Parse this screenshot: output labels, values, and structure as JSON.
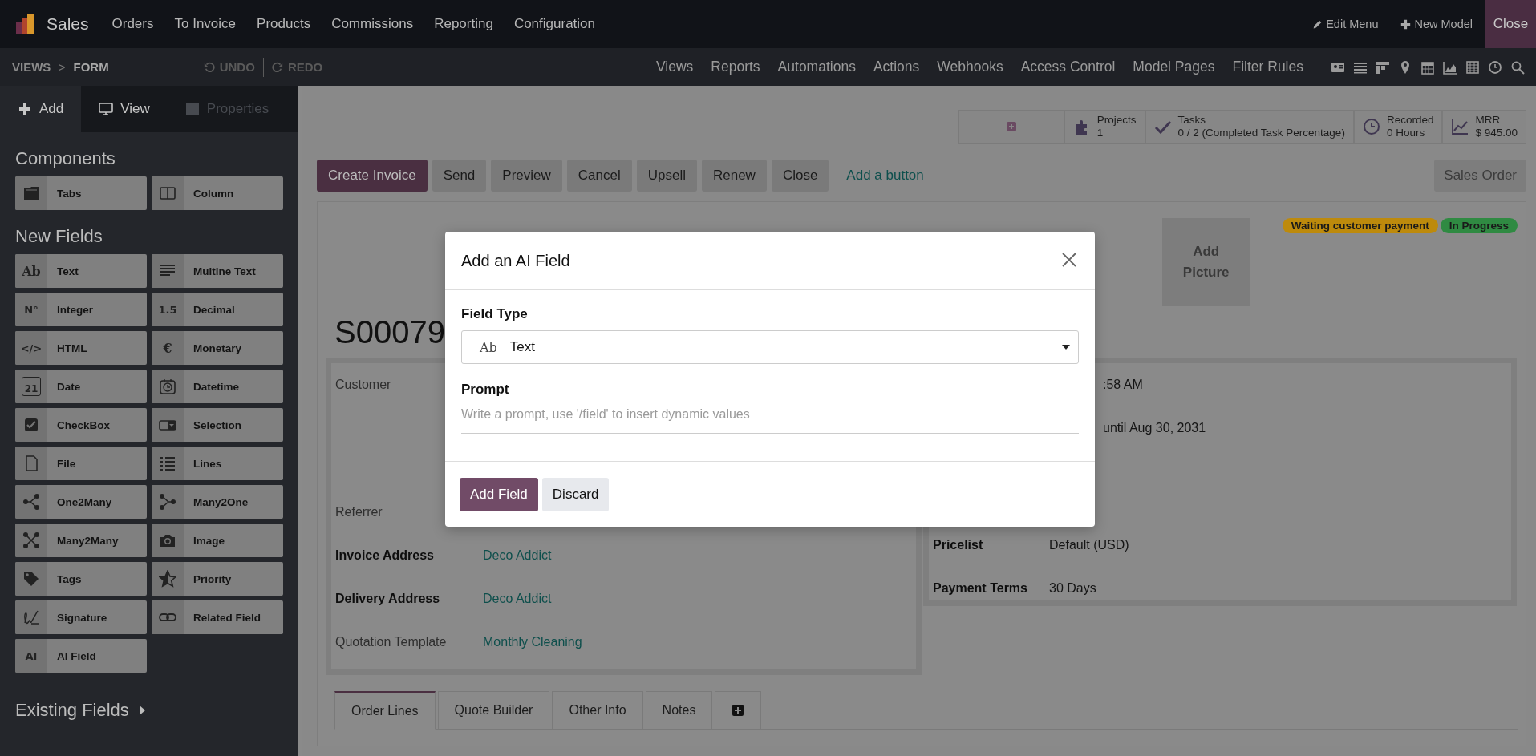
{
  "app": {
    "name": "Sales",
    "menu": [
      "Orders",
      "To Invoice",
      "Products",
      "Commissions",
      "Reporting",
      "Configuration"
    ],
    "actions": [
      {
        "label": "Edit Menu",
        "kind": "edit"
      },
      {
        "label": "New Model",
        "kind": "add"
      }
    ],
    "close": "Close"
  },
  "studio_bar": {
    "breadcrumb": [
      "VIEWS",
      "FORM"
    ],
    "separator": ">",
    "undo": "UNDO",
    "redo": "REDO",
    "menu": [
      "Views",
      "Reports",
      "Automations",
      "Actions",
      "Webhooks",
      "Access Control",
      "Model Pages",
      "Filter Rules"
    ]
  },
  "sidebar": {
    "tabs": [
      {
        "label": "Add",
        "kind": "add",
        "selected": true,
        "disabled": false
      },
      {
        "label": "View",
        "kind": "view",
        "selected": false,
        "disabled": false
      },
      {
        "label": "Properties",
        "kind": "properties",
        "selected": false,
        "disabled": true
      }
    ],
    "sections": [
      {
        "title": "Components",
        "items": [
          {
            "label": "Tabs",
            "kind": "tabs"
          },
          {
            "label": "Column",
            "kind": "column"
          }
        ]
      },
      {
        "title": "New Fields",
        "items": [
          {
            "label": "Text",
            "kind": "glyph",
            "glyph": "Ab"
          },
          {
            "label": "Multine Text",
            "kind": "multiline"
          },
          {
            "label": "Integer",
            "kind": "glyph",
            "glyph": "N°"
          },
          {
            "label": "Decimal",
            "kind": "glyph",
            "glyph": "1.5"
          },
          {
            "label": "HTML",
            "kind": "glyph",
            "glyph": "</>"
          },
          {
            "label": "Monetary",
            "kind": "glyph",
            "glyph": "€"
          },
          {
            "label": "Date",
            "kind": "calendar",
            "glyph": "21"
          },
          {
            "label": "Datetime",
            "kind": "datetime"
          },
          {
            "label": "CheckBox",
            "kind": "checkbox"
          },
          {
            "label": "Selection",
            "kind": "selection"
          },
          {
            "label": "File",
            "kind": "file"
          },
          {
            "label": "Lines",
            "kind": "lines"
          },
          {
            "label": "One2Many",
            "kind": "one2many"
          },
          {
            "label": "Many2One",
            "kind": "many2one"
          },
          {
            "label": "Many2Many",
            "kind": "many2many"
          },
          {
            "label": "Image",
            "kind": "image"
          },
          {
            "label": "Tags",
            "kind": "tags"
          },
          {
            "label": "Priority",
            "kind": "priority"
          },
          {
            "label": "Signature",
            "kind": "signature"
          },
          {
            "label": "Related Field",
            "kind": "related"
          },
          {
            "label": "AI Field",
            "kind": "glyph",
            "glyph": "AI"
          }
        ]
      }
    ],
    "existing_fields": "Existing Fields"
  },
  "stat_buttons": [
    {
      "kind": "add"
    },
    {
      "kind": "projects",
      "label": "Projects",
      "value": "1"
    },
    {
      "kind": "tasks",
      "label": "Tasks",
      "value": "0 / 2 (Completed Task Percentage)"
    },
    {
      "kind": "recorded",
      "label": "Recorded",
      "value": "0 Hours"
    },
    {
      "kind": "mrr",
      "label": "MRR",
      "value": "$ 945.00"
    }
  ],
  "form_buttons": [
    {
      "label": "Create Invoice",
      "primary": true
    },
    {
      "label": "Send",
      "primary": false
    },
    {
      "label": "Preview",
      "primary": false
    },
    {
      "label": "Cancel",
      "primary": false
    },
    {
      "label": "Upsell",
      "primary": false
    },
    {
      "label": "Renew",
      "primary": false
    },
    {
      "label": "Close",
      "primary": false
    }
  ],
  "add_button": "Add a button",
  "view_title": "Sales Order",
  "record": {
    "name": "S00079",
    "badges": [
      {
        "label": "Waiting customer payment",
        "color": "#bd8a0c"
      },
      {
        "label": "In Progress",
        "color": "#2f8a42"
      }
    ],
    "picture": "Add Picture",
    "left_fields": [
      {
        "label": "Customer",
        "required": false
      },
      {
        "label": "Referrer",
        "required": false
      },
      {
        "label": "Invoice Address",
        "value": "Deco Addict",
        "required": true
      },
      {
        "label": "Delivery Address",
        "value": "Deco Addict",
        "required": true
      },
      {
        "label": "Quotation Template",
        "value": "Monthly Cleaning",
        "required": false
      }
    ],
    "right_fields": [
      {
        "value": ":58 AM"
      },
      {
        "value": "until Aug 30, 2031"
      },
      {
        "label": "Pricelist",
        "value": "Default (USD)",
        "required": true
      },
      {
        "label": "Payment Terms",
        "value": "30 Days",
        "required": true
      }
    ],
    "tabs": [
      {
        "label": "Order Lines",
        "selected": true
      },
      {
        "label": "Quote Builder",
        "selected": false
      },
      {
        "label": "Other Info",
        "selected": false
      },
      {
        "label": "Notes",
        "selected": false
      }
    ],
    "add_tab": true
  },
  "dialog": {
    "title": "Add an AI Field",
    "field_type_label": "Field Type",
    "field_type": {
      "glyph": "Ab",
      "value": "Text"
    },
    "prompt_label": "Prompt",
    "prompt_placeholder": "Write a prompt, use '/field' to insert dynamic values",
    "buttons": [
      {
        "label": "Add Field",
        "primary": true
      },
      {
        "label": "Discard",
        "primary": false
      }
    ]
  }
}
